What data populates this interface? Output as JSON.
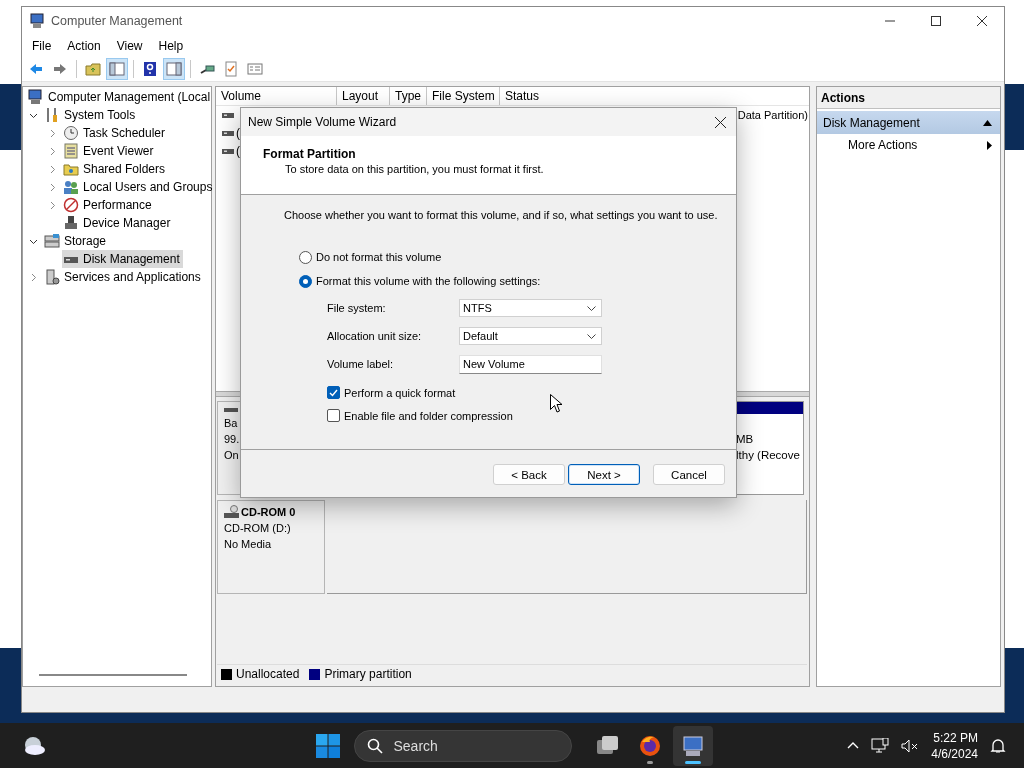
{
  "window": {
    "title": "Computer Management"
  },
  "menu": [
    "File",
    "Action",
    "View",
    "Help"
  ],
  "toolbar": [
    {
      "pressed": false
    },
    {
      "pressed": false
    },
    {
      "pressed": false
    },
    {
      "pressed": true
    },
    {
      "pressed": false
    },
    {
      "pressed": true
    },
    {
      "pressed": false
    },
    {
      "pressed": false
    },
    {
      "pressed": false
    }
  ],
  "tree": {
    "items": [
      {
        "label": "Computer Management (Local",
        "selected": false,
        "children": [
          {
            "label": "System Tools",
            "expanded": true,
            "selected": false,
            "children": [
              {
                "label": "Task Scheduler",
                "expanded": false,
                "selected": false
              },
              {
                "label": "Event Viewer",
                "expanded": false,
                "selected": false
              },
              {
                "label": "Shared Folders",
                "expanded": false,
                "selected": false
              },
              {
                "label": "Local Users and Groups",
                "expanded": false,
                "selected": false
              },
              {
                "label": "Performance",
                "expanded": false,
                "selected": false
              },
              {
                "label": "Device Manager",
                "selected": false
              }
            ]
          },
          {
            "label": "Storage",
            "expanded": true,
            "selected": false,
            "children": [
              {
                "label": "Disk Management",
                "selected": true
              }
            ]
          },
          {
            "label": "Services and Applications",
            "expanded": false,
            "selected": false
          }
        ]
      }
    ]
  },
  "volume_list": {
    "columns": [
      "Volume",
      "Layout",
      "Type",
      "File System",
      "Status"
    ],
    "rows": [
      {
        "status": "Data Partition)"
      },
      {
        "volume": "("
      },
      {
        "volume": "("
      }
    ]
  },
  "disks": [
    {
      "kind": "disk",
      "lines": [
        "Ba",
        "99.",
        "On"
      ],
      "partitions": [
        {
          "lines": [
            "MB",
            "lthy (Recove"
          ]
        }
      ]
    },
    {
      "kind": "cdrom",
      "name": "CD-ROM 0",
      "lines": [
        "CD-ROM (D:)",
        "No Media"
      ]
    }
  ],
  "legend": [
    {
      "label": "Unallocated",
      "color": "#000000"
    },
    {
      "label": "Primary partition",
      "color": "#000080"
    }
  ],
  "actions": {
    "title": "Actions",
    "section": "Disk Management",
    "items": [
      "More Actions"
    ]
  },
  "dialog": {
    "title": "New Simple Volume Wizard",
    "heading": "Format Partition",
    "subtitle": "To store data on this partition, you must format it first.",
    "instruction": "Choose whether you want to format this volume, and if so, what settings you want to use.",
    "options": [
      {
        "label": "Do not format this volume",
        "selected": false
      },
      {
        "label": "Format this volume with the following settings:",
        "selected": true
      }
    ],
    "fields": [
      {
        "label": "File system:",
        "value": "NTFS",
        "kind": "dropdown"
      },
      {
        "label": "Allocation unit size:",
        "value": "Default",
        "kind": "dropdown"
      },
      {
        "label": "Volume label:",
        "value": "New Volume",
        "kind": "text"
      }
    ],
    "checkboxes": [
      {
        "label": "Perform a quick format",
        "checked": true
      },
      {
        "label": "Enable file and folder compression",
        "checked": false
      }
    ],
    "buttons": [
      {
        "label": "< Back",
        "kind": "normal"
      },
      {
        "label": "Next >",
        "kind": "default"
      },
      {
        "label": "Cancel",
        "kind": "normal"
      }
    ]
  },
  "taskbar": {
    "search": {
      "placeholder": "Search"
    },
    "apps": [
      {
        "running": false,
        "selected": false
      },
      {
        "running": true,
        "selected": false
      },
      {
        "running": true,
        "selected": true
      }
    ],
    "clock": {
      "time": "5:22 PM",
      "date": "4/6/2024"
    }
  }
}
